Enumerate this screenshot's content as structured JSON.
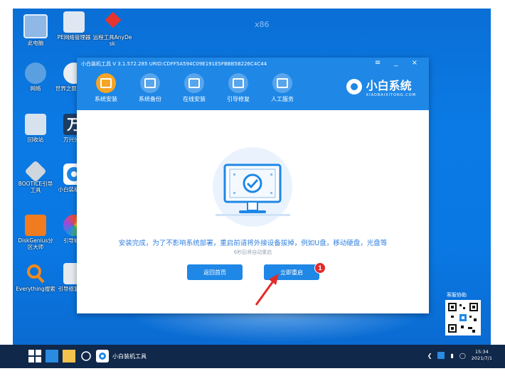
{
  "desktop": {
    "watermark": "x86",
    "icons": [
      {
        "label": "此电脑"
      },
      {
        "label": "PE网络管理器"
      },
      {
        "label": "远程工具AnyDesk"
      },
      {
        "label": "网络"
      },
      {
        "label": "世界之窗浏览器"
      },
      {
        "label": "回收站"
      },
      {
        "label": "万兴分区"
      },
      {
        "label": "BOOTICE引导工具"
      },
      {
        "label": "小白装机工具"
      },
      {
        "label": "DiskGenius分区大师"
      },
      {
        "label": "引导修复"
      },
      {
        "label": "Everything搜索"
      },
      {
        "label": "引导修复工具"
      }
    ],
    "qr_label": "客服协助"
  },
  "window": {
    "title": "小白装机工具 V 3.1.572.285 URID:CDFF5A594C09E191E5FBBB5B226C4C44",
    "controls": "≡ _ ×",
    "nav": [
      {
        "label": "系统安装",
        "active": true
      },
      {
        "label": "系统备份",
        "active": false
      },
      {
        "label": "在线安装",
        "active": false
      },
      {
        "label": "引导修复",
        "active": false
      },
      {
        "label": "人工服务",
        "active": false
      }
    ],
    "brand_name": "小白系统",
    "brand_sub": "XIAOBAIXITONG.COM",
    "message": "安装完成，为了不影响系统部署，重启前请将外接设备拔掉，例如U盘，移动硬盘，光盘等",
    "countdown": "6秒后将自动重启",
    "back_button": "返回首页",
    "restart_button": "立即重启",
    "restart_badge": "1"
  },
  "taskbar": {
    "app_label": "小白装机工具",
    "time": "15:34",
    "date": "2021/7/1"
  },
  "colors": {
    "accent": "#1f87e6",
    "active_nav": "#f5a524",
    "badge": "#e22b2b",
    "taskbar": "#10284a"
  }
}
